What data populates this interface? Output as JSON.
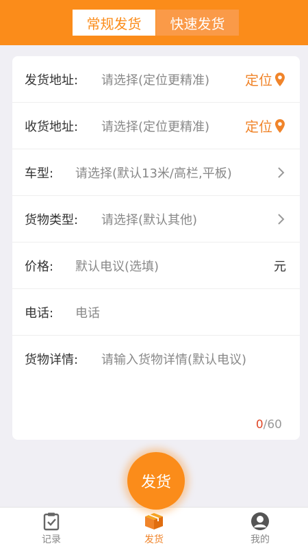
{
  "header": {
    "tabs": [
      {
        "label": "常规发货",
        "active": true
      },
      {
        "label": "快速发货",
        "active": false
      }
    ]
  },
  "form": {
    "ship_address": {
      "label": "发货地址:",
      "placeholder": "请选择(定位更精准)",
      "locate": "定位"
    },
    "receive_address": {
      "label": "收货地址:",
      "placeholder": "请选择(定位更精准)",
      "locate": "定位"
    },
    "vehicle": {
      "label": "车型:",
      "placeholder": "请选择(默认13米/高栏,平板)"
    },
    "cargo_type": {
      "label": "货物类型:",
      "placeholder": "请选择(默认其他)"
    },
    "price": {
      "label": "价格:",
      "placeholder": "默认电议(选填)",
      "unit": "元"
    },
    "phone": {
      "label": "电话:",
      "placeholder": "电话"
    },
    "details": {
      "label": "货物详情:",
      "placeholder": "请输入货物详情(默认电议)",
      "count": "0",
      "max": "/60"
    }
  },
  "submit_label": "发货",
  "tabbar": {
    "items": [
      {
        "label": "记录"
      },
      {
        "label": "发货"
      },
      {
        "label": "我的"
      }
    ]
  },
  "colors": {
    "accent": "#fb8c1a",
    "background": "#f0eff4"
  }
}
